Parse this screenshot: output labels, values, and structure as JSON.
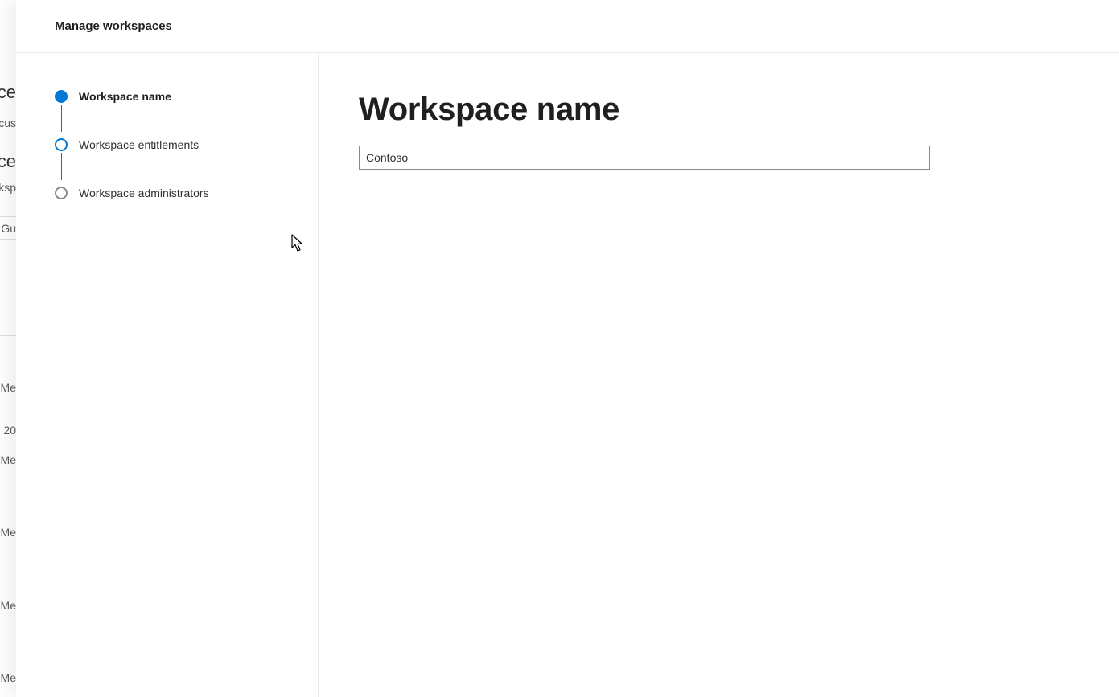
{
  "header": {
    "title": "Manage workspaces"
  },
  "stepper": {
    "steps": [
      {
        "label": "Workspace name",
        "state": "active"
      },
      {
        "label": "Workspace entitlements",
        "state": "next"
      },
      {
        "label": "Workspace administrators",
        "state": "inactive"
      }
    ]
  },
  "main": {
    "heading": "Workspace name",
    "input_value": "Contoso"
  },
  "background_fragments": {
    "f1": "ce",
    "f2": "cus",
    "f3": "ce",
    "f4": "rksp",
    "f5": " Gu",
    "f6": "Me",
    "f7": "20",
    "f8": "Me",
    "f9": "Me",
    "f10": "Me",
    "f11": "Me"
  }
}
